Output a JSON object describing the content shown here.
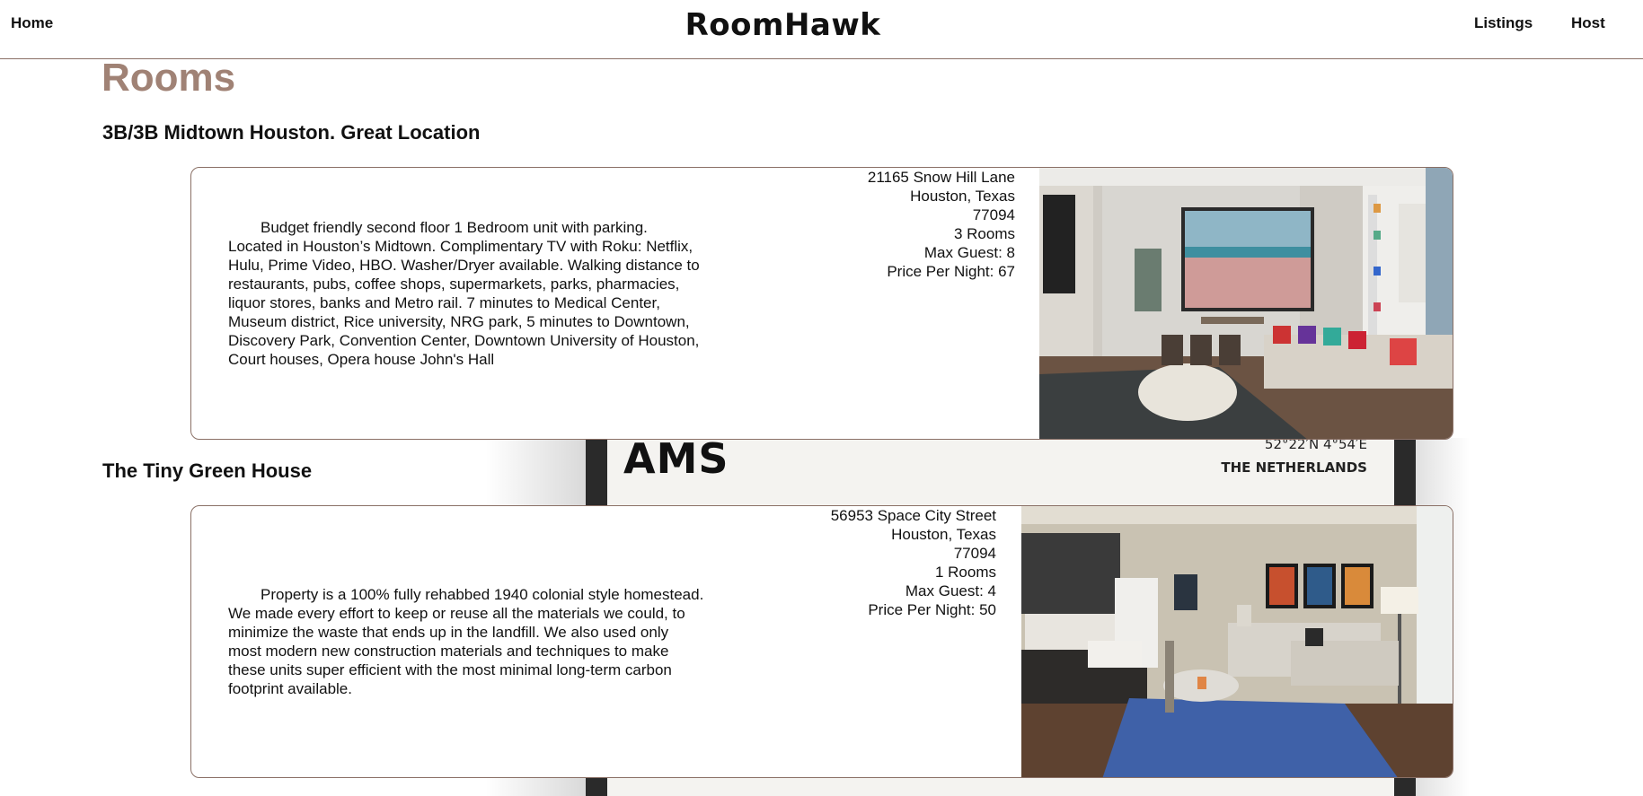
{
  "nav": {
    "home": "Home",
    "brand": "RoomHawk",
    "listings": "Listings",
    "host": "Host"
  },
  "page": {
    "title": "Rooms"
  },
  "poster": {
    "headline": "AMS",
    "coords": "52°22′N 4°54′E",
    "country": "THE NETHERLANDS"
  },
  "listings": [
    {
      "title": "3B/3B Midtown Houston. Great Location",
      "description": "Budget friendly second floor 1 Bedroom unit with parking. Located in Houston’s Midtown. Complimentary TV with Roku: Netflix, Hulu, Prime Video, HBO. Washer/Dryer available. Walking distance to restaurants, pubs, coffee shops, supermarkets, parks, pharmacies, liquor stores, banks and Metro rail. 7 minutes to Medical Center, Museum district, Rice university, NRG park, 5 minutes to Downtown, Discovery Park, Convention Center, Downtown University of Houston, Court houses, Opera house John's Hall",
      "street": "21165 Snow Hill Lane",
      "city": "Houston, Texas",
      "zip": "77094",
      "rooms": "3 Rooms",
      "max_guest": "Max Guest: 8",
      "price": "Price Per Night: 67"
    },
    {
      "title": "The Tiny Green House",
      "description": "Property is a 100% fully rehabbed 1940 colonial style homestead. We made every effort to keep or reuse all the materials we could, to minimize the waste that ends up in the landfill. We also used only most modern new construction materials and techniques to make these units super efficient with the most minimal long-term carbon footprint available.",
      "street": "56953 Space City Street",
      "city": "Houston, Texas",
      "zip": "77094",
      "rooms": "1 Rooms",
      "max_guest": "Max Guest: 4",
      "price": "Price Per Night: 50"
    }
  ]
}
